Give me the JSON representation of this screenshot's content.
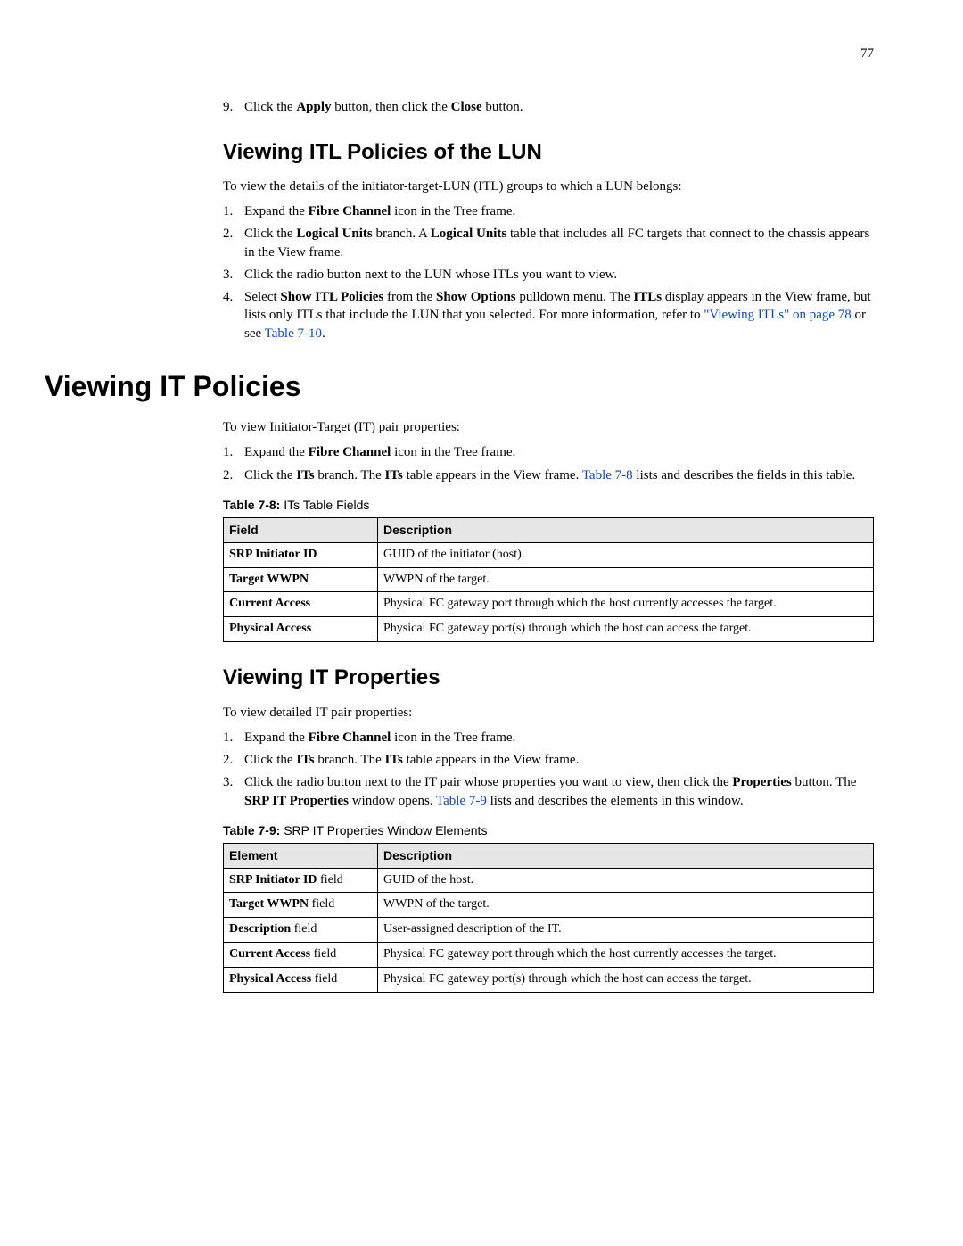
{
  "page_number": "77",
  "step9": {
    "num": "9.",
    "pre": "Click the ",
    "b1": "Apply",
    "mid": " button, then click the ",
    "b2": "Close",
    "post": " button."
  },
  "section1": {
    "heading": "Viewing ITL Policies of the LUN",
    "intro": "To view the details of the initiator-target-LUN (ITL) groups to which a LUN belongs:",
    "steps": {
      "s1": {
        "num": "1.",
        "pre": "Expand the ",
        "b1": "Fibre Channel",
        "post": " icon in the Tree frame."
      },
      "s2": {
        "num": "2.",
        "pre": "Click the ",
        "b1": "Logical Units",
        "mid": " branch. A ",
        "b2": "Logical Units",
        "post": " table that includes all FC targets that connect to the chassis appears in the View frame."
      },
      "s3": {
        "num": "3.",
        "text": "Click the radio button next to the LUN whose ITLs you want to view."
      },
      "s4": {
        "num": "4.",
        "pre": "Select ",
        "b1": "Show ITL Policies",
        "mid1": " from the ",
        "b2": "Show Options",
        "mid2": " pulldown menu. The ",
        "b3": "ITLs",
        "mid3": " display appears in the View frame, but lists only ITLs that include the LUN that you selected. For more information, refer to ",
        "link": "\"Viewing ITLs\" on page 78",
        "mid4": " or see ",
        "link2": "Table 7-10",
        "post": "."
      }
    }
  },
  "section2": {
    "heading": "Viewing IT Policies",
    "intro": "To view Initiator-Target (IT) pair properties:",
    "steps": {
      "s1": {
        "num": "1.",
        "pre": "Expand the ",
        "b1": "Fibre Channel",
        "post": " icon in the Tree frame."
      },
      "s2": {
        "num": "2.",
        "pre": "Click the ",
        "b1": "ITs",
        "mid1": " branch. The ",
        "b2": "ITs",
        "mid2": " table appears in the View frame. ",
        "link": "Table 7-8",
        "post": " lists and describes the fields in this table."
      }
    },
    "table_caption_bold": "Table 7-8:",
    "table_caption_rest": " ITs Table Fields",
    "table": {
      "h1": "Field",
      "h2": "Description",
      "rows": [
        {
          "field": "SRP Initiator ID",
          "desc": "GUID of the initiator (host)."
        },
        {
          "field": "Target WWPN",
          "desc": "WWPN of the target."
        },
        {
          "field": "Current Access",
          "desc": "Physical FC gateway port through which the host currently accesses the target."
        },
        {
          "field": "Physical Access",
          "desc": "Physical FC gateway port(s) through which the host can access the target."
        }
      ]
    }
  },
  "section3": {
    "heading": "Viewing IT Properties",
    "intro": "To view detailed IT pair properties:",
    "steps": {
      "s1": {
        "num": "1.",
        "pre": "Expand the ",
        "b1": "Fibre Channel",
        "post": " icon in the Tree frame."
      },
      "s2": {
        "num": "2.",
        "pre": "Click the ",
        "b1": "ITs",
        "mid1": " branch. The ",
        "b2": "ITs",
        "post": " table appears in the View frame."
      },
      "s3": {
        "num": "3.",
        "pre": "Click the radio button next to the IT pair whose properties you want to view, then click the ",
        "b1": "Properties",
        "mid1": " button. The ",
        "b2": "SRP IT Properties",
        "mid2": " window opens. ",
        "link": "Table 7-9",
        "post": " lists and describes the elements in this window."
      }
    },
    "table_caption_bold": "Table 7-9:",
    "table_caption_rest": " SRP IT Properties Window Elements",
    "table": {
      "h1": "Element",
      "h2": "Description",
      "rows": [
        {
          "field_b": "SRP Initiator ID",
          "field_n": " field",
          "desc": "GUID of the host."
        },
        {
          "field_b": "Target WWPN",
          "field_n": " field",
          "desc": "WWPN of the target."
        },
        {
          "field_b": "Description",
          "field_n": " field",
          "desc": "User-assigned description of the IT."
        },
        {
          "field_b": "Current Access",
          "field_n": " field",
          "desc": "Physical FC gateway port through which the host currently accesses the target."
        },
        {
          "field_b": "Physical Access",
          "field_n": " field",
          "desc": "Physical FC gateway port(s) through which the host can access the target."
        }
      ]
    }
  }
}
